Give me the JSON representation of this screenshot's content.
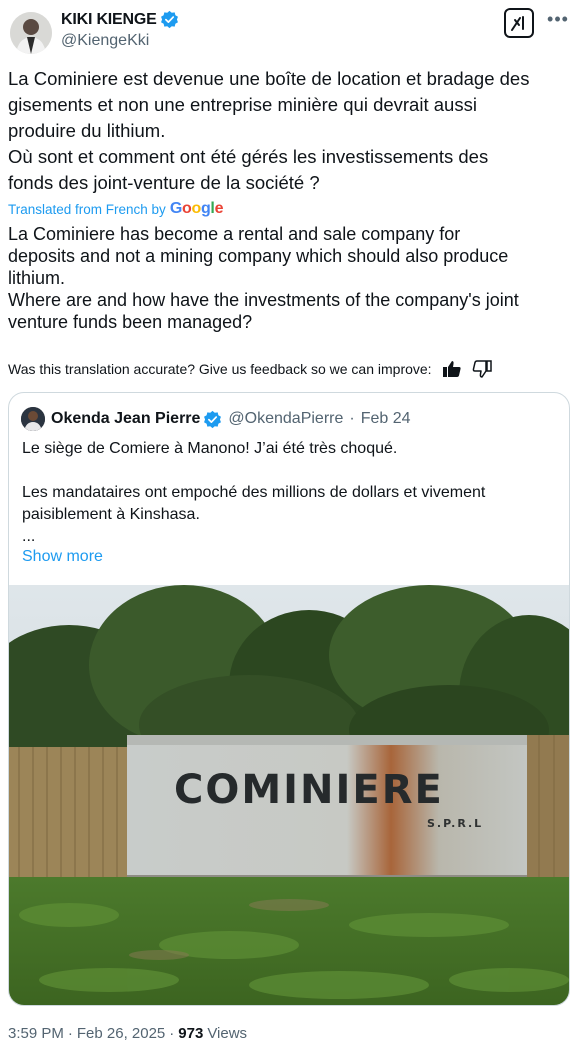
{
  "author": {
    "name": "KIKI KIENGE",
    "handle": "@KiengeKki",
    "verified": true
  },
  "tweet": {
    "original_text": "La Cominiere est devenue une boîte de location et bradage des\ngisements et non une entreprise minière qui devrait aussi\nproduire du lithium.\nOù sont et comment ont été gérés les investissements des\nfonds des joint-venture de la société ?",
    "translated_from": "Translated from French by",
    "translation_provider": "Google",
    "translation_text": "La Cominiere has become a rental and sale company for\ndeposits and not a mining company which should also produce\nlithium.\nWhere are and how have the investments of the company's joint\nventure funds been managed?",
    "feedback_prompt": "Was this translation accurate? Give us feedback so we can improve:"
  },
  "quote": {
    "name": "Okenda Jean Pierre",
    "handle": "@OkendaPierre",
    "separator": "·",
    "date": "Feb 24",
    "text": "Le siège de Comiere à Manono! J’ai été très choqué.\n\nLes mandataires ont empoché des millions de dollars et vivement\npaisiblement à Kinshasa.\n...",
    "show_more": "Show more",
    "photo": {
      "sign_text": "COMINIERE",
      "sign_subtext": "S.P.R.L"
    }
  },
  "footer": {
    "time": "3:59 PM",
    "separator": "·",
    "date": "Feb 26, 2025",
    "separator2": "·",
    "views_count": "973",
    "views_label": "Views"
  },
  "colors": {
    "accent": "#1d9bf0",
    "secondary_text": "#536471",
    "border": "#cfd9de"
  }
}
